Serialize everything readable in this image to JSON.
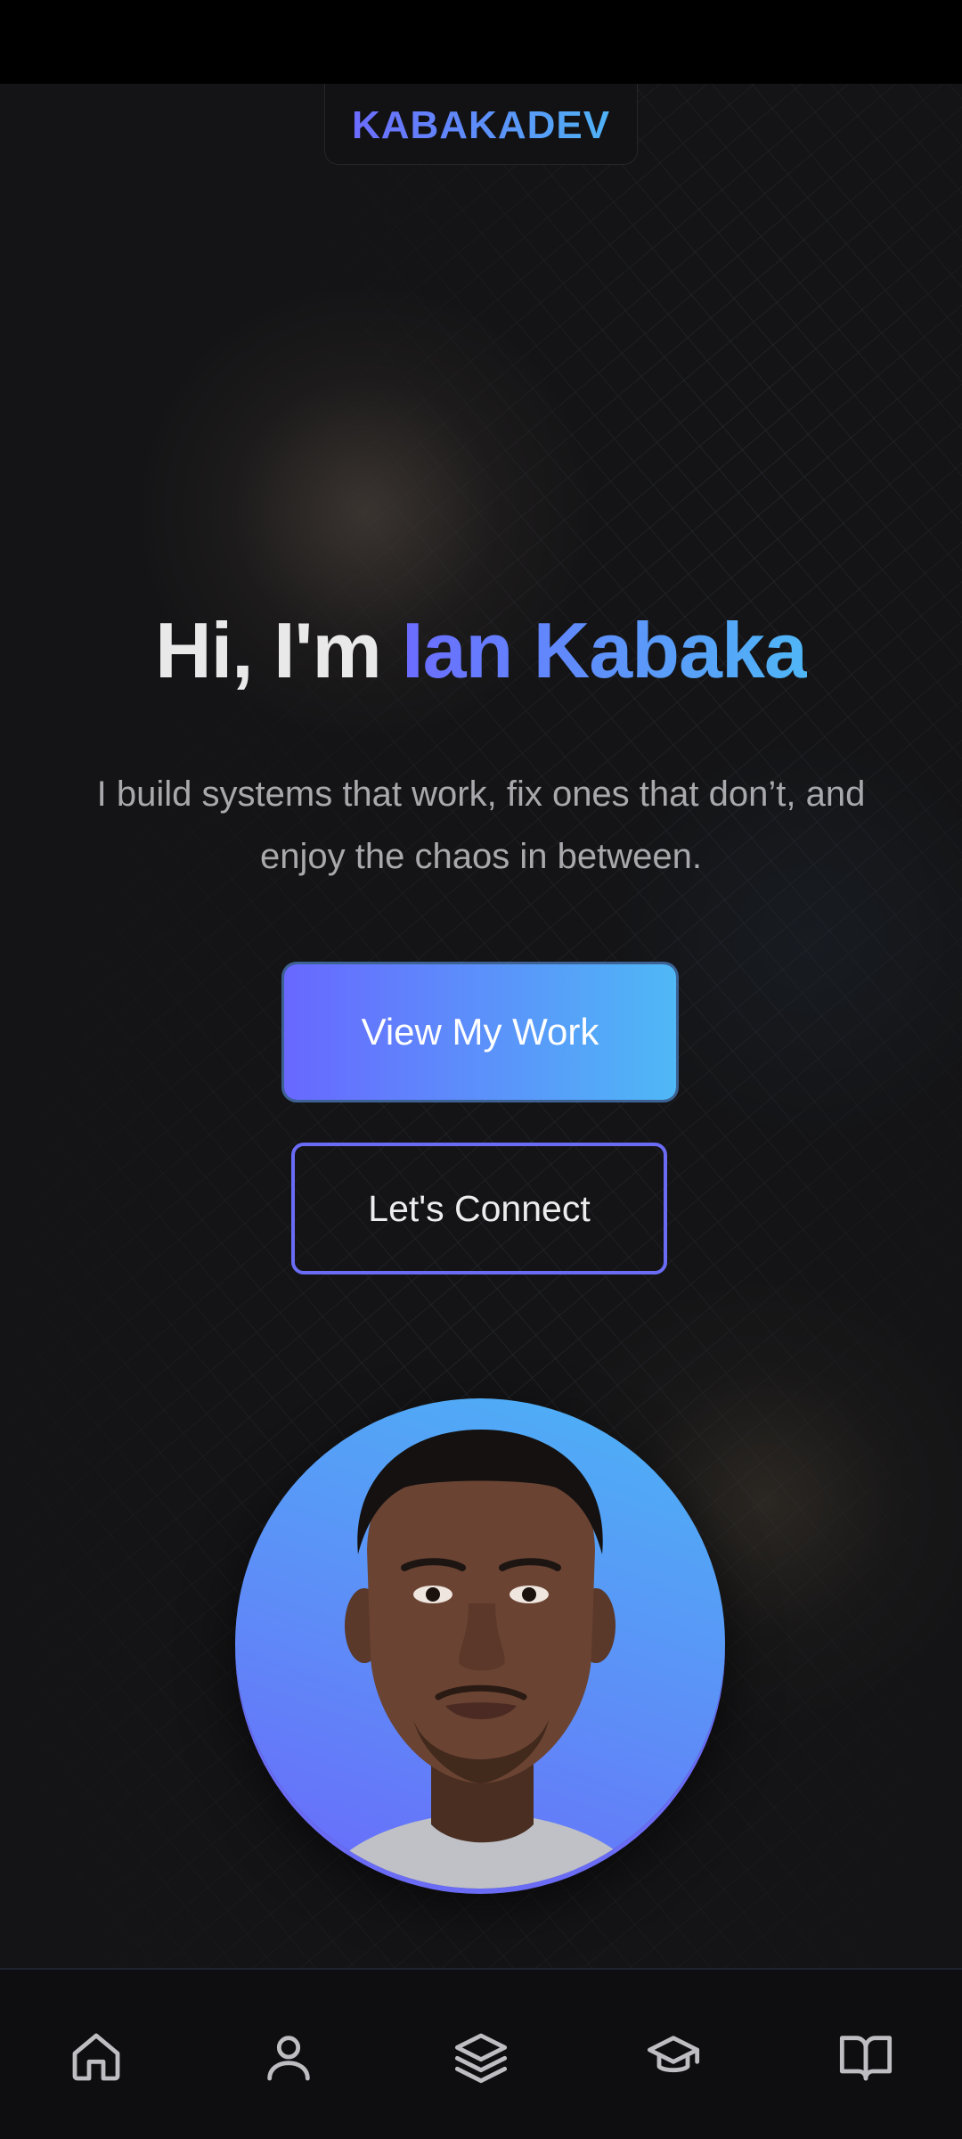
{
  "brand": {
    "name": "KABAKADEV"
  },
  "hero": {
    "greeting": "Hi, I'm",
    "name": "Ian Kabaka",
    "subtitle": "I build systems that work, fix ones that don’t, and enjoy the chaos in between."
  },
  "buttons": {
    "primary_label": "View My Work",
    "secondary_label": "Let's Connect"
  },
  "nav": {
    "items": [
      {
        "icon": "home-icon"
      },
      {
        "icon": "user-icon"
      },
      {
        "icon": "layers-icon"
      },
      {
        "icon": "graduation-cap-icon"
      },
      {
        "icon": "book-open-icon"
      }
    ]
  },
  "colors": {
    "accent_start": "#6868ff",
    "accent_end": "#4fb8f6",
    "background": "#141416"
  }
}
